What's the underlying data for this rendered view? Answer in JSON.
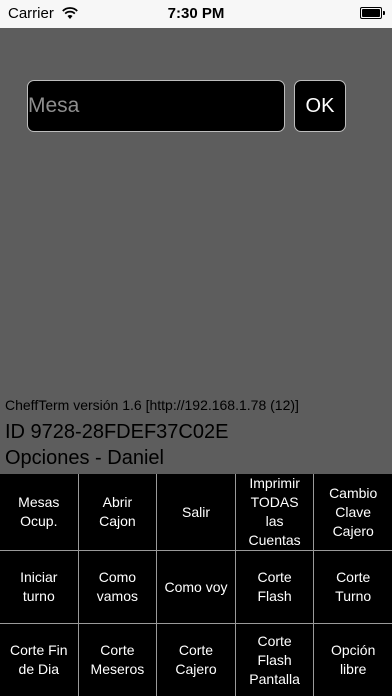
{
  "status_bar": {
    "carrier": "Carrier",
    "time": "7:30 PM",
    "wifi_icon": "wifi-icon",
    "battery_icon": "battery-icon"
  },
  "mesa": {
    "placeholder": "Mesa",
    "value": ""
  },
  "ok_label": "OK",
  "info": {
    "version": "CheffTerm versión 1.6 [http://192.168.1.78 (12)]",
    "device_id": "ID 9728-28FDEF37C02E",
    "options_user": "Opciones - Daniel"
  },
  "buttons": [
    "Mesas\nOcup.",
    "Abrir\nCajon",
    "Salir",
    "Imprimir\nTODAS las\nCuentas",
    "Cambio\nClave\nCajero",
    "Iniciar\nturno",
    "Como\nvamos",
    "Como voy",
    "Corte\nFlash",
    "Corte\nTurno",
    "Corte Fin\nde Dia",
    "Corte\nMeseros",
    "Corte\nCajero",
    "Corte\nFlash\nPantalla",
    "Opción\nlibre"
  ],
  "colors": {
    "background": "#5d5d5d",
    "button_bg": "#000000",
    "button_text": "#ffffff"
  }
}
